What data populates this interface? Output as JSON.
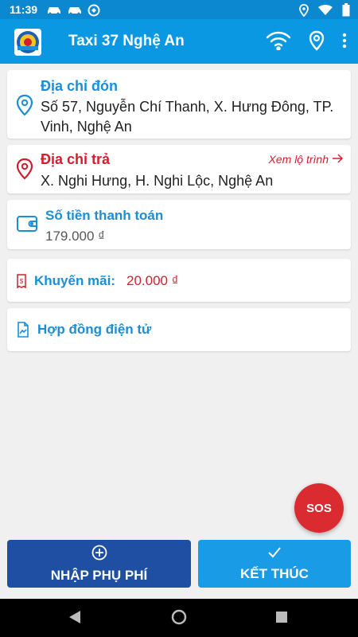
{
  "status_bar": {
    "time": "11:39"
  },
  "app_bar": {
    "title": "Taxi 37 Nghệ An"
  },
  "pickup": {
    "label": "Địa chỉ đón",
    "address": "Số 57, Nguyễn Chí Thanh, X. Hưng Đông, TP. Vinh, Nghệ An"
  },
  "dropoff": {
    "label": "Địa chỉ trả",
    "view_route": "Xem lộ trình",
    "address": "X. Nghi Hưng, H. Nghi Lộc, Nghệ An"
  },
  "payment": {
    "label": "Số tiền thanh toán",
    "amount": "179.000 ₫"
  },
  "promotion": {
    "label": "Khuyến mãi:",
    "amount": "20.000 ₫"
  },
  "contract": {
    "label": "Hợp đồng điện tử"
  },
  "sos": {
    "label": "SOS"
  },
  "buttons": {
    "surcharge": "NHẬP PHỤ PHÍ",
    "finish": "KẾT THÚC"
  },
  "colors": {
    "primary": "#0b98e3",
    "status_bar": "#0b88d0",
    "accent_blue": "#1a8ed6",
    "accent_red": "#d0202d",
    "surcharge_button": "#1e4fa3",
    "finish_button": "#1a9be6",
    "sos": "#d92b30"
  }
}
